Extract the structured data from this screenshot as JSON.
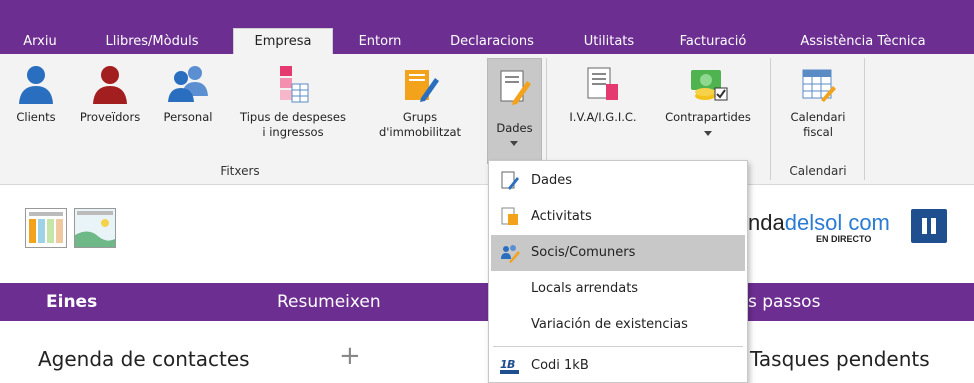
{
  "tabs": [
    "Arxiu",
    "Llibres/Mòduls",
    "Empresa",
    "Entorn",
    "Declaracions",
    "Utilitats",
    "Facturació",
    "Assistència Tècnica"
  ],
  "active_tab": "Empresa",
  "ribbon": {
    "clients": "Clients",
    "proveidors": "Proveïdors",
    "personal": "Personal",
    "tipus_line1": "Tipus de despeses",
    "tipus_line2": "i ingressos",
    "grups_line1": "Grups",
    "grups_line2": "d'immobilitzat",
    "dades": "Dades",
    "iva": "I.V.A/I.G.I.C.",
    "contrapartides": "Contrapartides",
    "calendari_line1": "Calendari",
    "calendari_line2": "fiscal",
    "group_fitxers": "Fitxers",
    "group_calendari": "Calendari"
  },
  "brand": {
    "prefix": "nda",
    "accent": "delsol",
    "suffix": " com",
    "sub": "EN DIRECTO"
  },
  "purplebar": {
    "eines": "Eines",
    "resumeixen": "Resumeixen",
    "passos": "s passos"
  },
  "lower": {
    "agenda": "Agenda de contactes",
    "plus": "+",
    "tasques": "Tasques pendents"
  },
  "dropdown": {
    "items": [
      "Dades",
      "Activitats",
      "Socis/Comuners",
      "Locals arrendats",
      "Variación de existencias",
      "Codi 1kB"
    ],
    "highlighted": "Socis/Comuners"
  },
  "colors": {
    "purple": "#6d2e91",
    "ribbon_bg": "#f3f3f3",
    "highlight": "#c8c8c8",
    "brand_blue": "#2a7bd3"
  }
}
